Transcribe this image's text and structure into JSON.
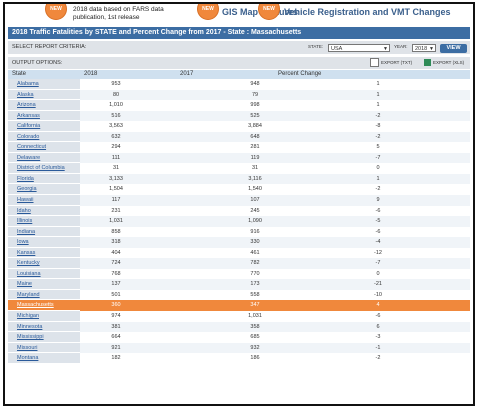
{
  "banner": {
    "badge1": "NEW",
    "text1": "2018 data based on FARS data publication, 1st release",
    "badge2": "NEW",
    "text2": "GIS Map Features",
    "badge3": "NEW",
    "text3": "Vehicle Registration and VMT Changes"
  },
  "title": "2018 Traffic Fatalities by STATE and Percent Change from 2017 - State : Massachusetts",
  "criteria": {
    "label": "SELECT REPORT CRITERIA:",
    "state_label": "STATE:",
    "state_value": "USA",
    "year_label": "YEAR:",
    "year_value": "2018",
    "view_button": "VIEW"
  },
  "output": {
    "label": "OUTPUT OPTIONS:",
    "export_txt": "EXPORT (TXT)",
    "export_xls": "EXPORT (XLS)"
  },
  "columns": [
    "State",
    "2018",
    "2017",
    "Percent Change"
  ],
  "rows": [
    {
      "state": "Alabama",
      "y2018": "953",
      "y2017": "948",
      "pct": "1"
    },
    {
      "state": "Alaska",
      "y2018": "80",
      "y2017": "79",
      "pct": "1"
    },
    {
      "state": "Arizona",
      "y2018": "1,010",
      "y2017": "998",
      "pct": "1"
    },
    {
      "state": "Arkansas",
      "y2018": "516",
      "y2017": "525",
      "pct": "-2"
    },
    {
      "state": "California",
      "y2018": "3,563",
      "y2017": "3,884",
      "pct": "-8"
    },
    {
      "state": "Colorado",
      "y2018": "632",
      "y2017": "648",
      "pct": "-2"
    },
    {
      "state": "Connecticut",
      "y2018": "294",
      "y2017": "281",
      "pct": "5"
    },
    {
      "state": "Delaware",
      "y2018": "111",
      "y2017": "119",
      "pct": "-7"
    },
    {
      "state": "District of Columbia",
      "y2018": "31",
      "y2017": "31",
      "pct": "0"
    },
    {
      "state": "Florida",
      "y2018": "3,133",
      "y2017": "3,116",
      "pct": "1"
    },
    {
      "state": "Georgia",
      "y2018": "1,504",
      "y2017": "1,540",
      "pct": "-2"
    },
    {
      "state": "Hawaii",
      "y2018": "117",
      "y2017": "107",
      "pct": "9"
    },
    {
      "state": "Idaho",
      "y2018": "231",
      "y2017": "245",
      "pct": "-6"
    },
    {
      "state": "Illinois",
      "y2018": "1,031",
      "y2017": "1,090",
      "pct": "-5"
    },
    {
      "state": "Indiana",
      "y2018": "858",
      "y2017": "916",
      "pct": "-6"
    },
    {
      "state": "Iowa",
      "y2018": "318",
      "y2017": "330",
      "pct": "-4"
    },
    {
      "state": "Kansas",
      "y2018": "404",
      "y2017": "461",
      "pct": "-12"
    },
    {
      "state": "Kentucky",
      "y2018": "724",
      "y2017": "782",
      "pct": "-7"
    },
    {
      "state": "Louisiana",
      "y2018": "768",
      "y2017": "770",
      "pct": "0"
    },
    {
      "state": "Maine",
      "y2018": "137",
      "y2017": "173",
      "pct": "-21"
    },
    {
      "state": "Maryland",
      "y2018": "501",
      "y2017": "558",
      "pct": "-10"
    },
    {
      "state": "Massachusetts",
      "y2018": "360",
      "y2017": "347",
      "pct": "4",
      "highlight": true
    },
    {
      "state": "Michigan",
      "y2018": "974",
      "y2017": "1,031",
      "pct": "-6"
    },
    {
      "state": "Minnesota",
      "y2018": "381",
      "y2017": "358",
      "pct": "6"
    },
    {
      "state": "Mississippi",
      "y2018": "664",
      "y2017": "685",
      "pct": "-3"
    },
    {
      "state": "Missouri",
      "y2018": "921",
      "y2017": "932",
      "pct": "-1"
    },
    {
      "state": "Montana",
      "y2018": "182",
      "y2017": "186",
      "pct": "-2"
    }
  ],
  "colors": {
    "accent": "#3c6da3",
    "highlight": "#f0883c"
  }
}
